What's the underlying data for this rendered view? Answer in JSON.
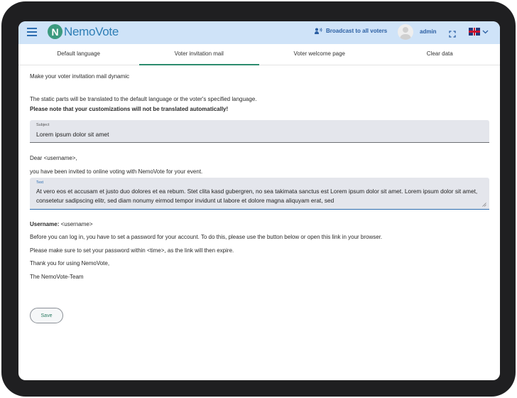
{
  "appbar": {
    "logo_letter": "N",
    "logo_text": "NemoVote",
    "broadcast_label": "Broadcast to all voters",
    "user_name": "admin"
  },
  "tabs": [
    {
      "label": "Default language",
      "active": false
    },
    {
      "label": "Voter invitation mail",
      "active": true
    },
    {
      "label": "Voter welcome page",
      "active": false
    },
    {
      "label": "Clear data",
      "active": false
    }
  ],
  "content": {
    "intro": "Make your voter invitation mail dynamic",
    "static_note": "The static parts will be translated to the default language or the voter's specified language.",
    "warning": "Please note that your customizations will not be translated automatically!",
    "subject": {
      "label": "Subject",
      "value": "Lorem ipsum dolor sit amet"
    },
    "greeting": "Dear <username>,",
    "invited": "you have been invited to online voting with NemoVote for your event.",
    "text": {
      "label": "Text",
      "value": "At vero eos et accusam et justo duo dolores et ea rebum. Stet clita kasd gubergren, no sea takimata sanctus est Lorem ipsum dolor sit amet. Lorem ipsum dolor sit amet, consetetur sadipscing elitr, sed diam nonumy eirmod tempor invidunt ut labore et dolore magna aliquyam erat, sed"
    },
    "username_label": "Username:",
    "username_value": "<username>",
    "login_info": "Before you can log in, you have to set a password for your account. To do this, please use the button below or open this link in your browser.",
    "expire_info": "Please make sure to set your password within <time>, as the link will then expire.",
    "thanks": "Thank you for using NemoVote,",
    "signature": "The NemoVote-Team",
    "save_label": "Save"
  },
  "colors": {
    "appbar": "#cfe3f8",
    "accent": "#2c8c6e",
    "link": "#2b5fa3"
  }
}
